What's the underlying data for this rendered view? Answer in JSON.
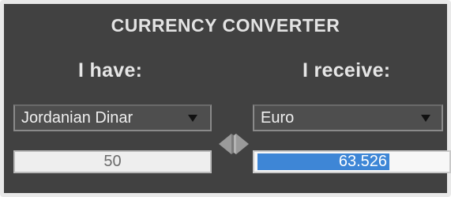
{
  "converter": {
    "title": "CURRENCY CONVERTER",
    "have_label": "I have:",
    "receive_label": "I receive:",
    "from_currency": "Jordanian Dinar",
    "to_currency": "Euro",
    "amount": "50",
    "result": "63.526",
    "swap_icon": "swap-arrows-icon",
    "colors": {
      "panel": "#414141",
      "border": "#e9e9e9",
      "selection": "#3e86d6"
    }
  }
}
